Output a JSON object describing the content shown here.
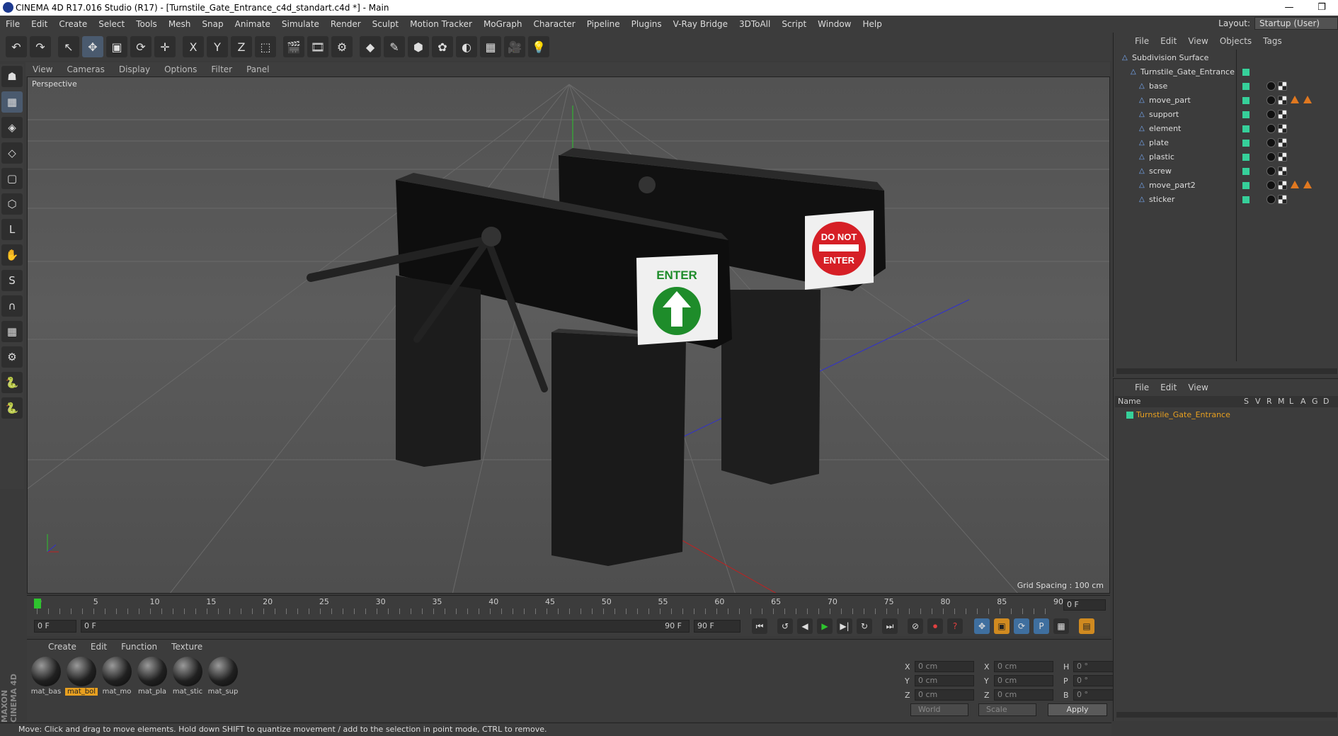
{
  "window": {
    "title": "CINEMA 4D R17.016 Studio (R17) - [Turnstile_Gate_Entrance_c4d_standart.c4d *] - Main",
    "min": "—",
    "max": "❐"
  },
  "menu": [
    "File",
    "Edit",
    "Create",
    "Select",
    "Tools",
    "Mesh",
    "Snap",
    "Animate",
    "Simulate",
    "Render",
    "Sculpt",
    "Motion Tracker",
    "MoGraph",
    "Character",
    "Pipeline",
    "Plugins",
    "V-Ray Bridge",
    "3DToAll",
    "Script",
    "Window",
    "Help"
  ],
  "layout": {
    "label": "Layout:",
    "value": "Startup (User)"
  },
  "toolbar_icons": [
    "undo-icon",
    "redo-icon",
    "select-arrow-icon",
    "move-icon",
    "scale-icon",
    "rotate-icon",
    "live-select-icon",
    "x-axis-icon",
    "y-axis-icon",
    "z-axis-icon",
    "coordinate-system-icon",
    "render-view-icon",
    "render-picture-viewer-icon",
    "edit-render-settings-icon",
    "cube-icon",
    "pen-icon",
    "subdivision-icon",
    "array-icon",
    "deformer-icon",
    "floor-icon",
    "camera-icon",
    "light-icon"
  ],
  "toolbar_glyphs": [
    "↶",
    "↷",
    "↖",
    "✥",
    "▣",
    "⟳",
    "✛",
    "X",
    "Y",
    "Z",
    "⬚",
    "🎬",
    "🎞",
    "⚙",
    "◆",
    "✎",
    "⬢",
    "✿",
    "◐",
    "▦",
    "🎥",
    "💡"
  ],
  "left_tools": [
    "☗",
    "▦",
    "◈",
    "◇",
    "▢",
    "⬡",
    "L",
    "✋",
    "S",
    "∩",
    "▦",
    "⚙",
    "🐍",
    "🐍"
  ],
  "viewport": {
    "menu": [
      "View",
      "Cameras",
      "Display",
      "Options",
      "Filter",
      "Panel"
    ],
    "label": "Perspective",
    "grid_spacing": "Grid Spacing : 100 cm"
  },
  "signs": {
    "enter": "ENTER",
    "do_not": "DO NOT",
    "do_not_enter": "ENTER"
  },
  "timeline": {
    "ticks": [
      "0",
      "5",
      "10",
      "15",
      "20",
      "25",
      "30",
      "35",
      "40",
      "45",
      "50",
      "55",
      "60",
      "65",
      "70",
      "75",
      "80",
      "85",
      "90"
    ],
    "frame_end": "0 F"
  },
  "playbar": {
    "start": "0 F",
    "range_start": "0 F",
    "range_end": "90 F",
    "end": "90 F"
  },
  "materials": {
    "menu": [
      "Create",
      "Edit",
      "Function",
      "Texture"
    ],
    "items": [
      {
        "label": "mat_bas",
        "selected": false
      },
      {
        "label": "mat_bol",
        "selected": true
      },
      {
        "label": "mat_mo",
        "selected": false
      },
      {
        "label": "mat_pla",
        "selected": false
      },
      {
        "label": "mat_stic",
        "selected": false
      },
      {
        "label": "mat_sup",
        "selected": false
      }
    ]
  },
  "coords": {
    "rows": [
      {
        "a": "X",
        "av": "0 cm",
        "b": "X",
        "bv": "0 cm",
        "c": "H",
        "cv": "0 °"
      },
      {
        "a": "Y",
        "av": "0 cm",
        "b": "Y",
        "bv": "0 cm",
        "c": "P",
        "cv": "0 °"
      },
      {
        "a": "Z",
        "av": "0 cm",
        "b": "Z",
        "bv": "0 cm",
        "c": "B",
        "cv": "0 °"
      }
    ],
    "space": "World",
    "mode": "Scale",
    "apply": "Apply"
  },
  "objects": {
    "menu": [
      "File",
      "Edit",
      "View",
      "Objects",
      "Tags"
    ],
    "items": [
      {
        "name": "Subdivision Surface",
        "indent": 0
      },
      {
        "name": "Turnstile_Gate_Entrance",
        "indent": 1
      },
      {
        "name": "base",
        "indent": 2
      },
      {
        "name": "move_part",
        "indent": 2
      },
      {
        "name": "support",
        "indent": 2
      },
      {
        "name": "element",
        "indent": 2
      },
      {
        "name": "plate",
        "indent": 2
      },
      {
        "name": "plastic",
        "indent": 2
      },
      {
        "name": "screw",
        "indent": 2
      },
      {
        "name": "move_part2",
        "indent": 2
      },
      {
        "name": "sticker",
        "indent": 2
      }
    ]
  },
  "attributes": {
    "menu": [
      "File",
      "Edit",
      "View"
    ],
    "columns": [
      "Name",
      "S",
      "V",
      "R",
      "M",
      "L",
      "A",
      "G",
      "D"
    ],
    "row": "Turnstile_Gate_Entrance"
  },
  "status": "Move: Click and drag to move elements. Hold down SHIFT to quantize movement / add to the selection in point mode, CTRL to remove.",
  "maxon": "MAXON CINEMA 4D",
  "colors": {
    "accent": "#e8a020",
    "visible_green": "#36d09a",
    "play_green": "#2ec42e",
    "sign_green": "#1e8c2a",
    "sign_red": "#d61f26"
  }
}
